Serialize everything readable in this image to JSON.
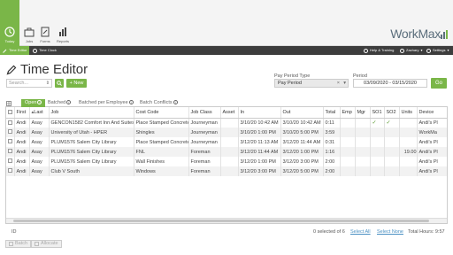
{
  "nav": {
    "items": [
      {
        "label": "Today",
        "icon": "today-icon"
      },
      {
        "label": "Jobs",
        "icon": "briefcase-icon"
      },
      {
        "label": "Forms",
        "icon": "forms-icon"
      },
      {
        "label": "Reports",
        "icon": "reports-icon"
      }
    ],
    "brand": {
      "text": "WorkMax",
      "suffix": ""
    }
  },
  "subnav": {
    "left": [
      {
        "label": "Time Editor",
        "icon": "time-editor-icon"
      },
      {
        "label": "Time Clock",
        "icon": "clock-icon"
      }
    ],
    "right": [
      {
        "label": "Help & Training",
        "icon": "help-icon"
      },
      {
        "label": "Zachary",
        "icon": "user-icon"
      },
      {
        "label": "Settings",
        "icon": "gear-icon"
      }
    ]
  },
  "page": {
    "title": "Time Editor"
  },
  "filters": {
    "search_placeholder": "Search...",
    "new_label": "+ New",
    "pay_period_type_label": "Pay Period Type",
    "pay_period_type_value": "Pay Period",
    "period_label": "Period",
    "period_value": "03/09/2020 - 03/15/2020",
    "go_label": "Go"
  },
  "tabs": [
    {
      "label": "Open",
      "active": true
    },
    {
      "label": "Batched",
      "active": false
    },
    {
      "label": "Batched per Employee",
      "active": false
    },
    {
      "label": "Batch Conflicts",
      "active": false
    }
  ],
  "table": {
    "columns": [
      "",
      "First",
      "Last",
      "Job",
      "Cost Code",
      "Job Class",
      "Asset",
      "In",
      "Out",
      "Total",
      "Emp",
      "Mgr",
      "SO1",
      "SO2",
      "Units",
      "Device"
    ],
    "rows": [
      {
        "first": "Andi",
        "last": "Asay",
        "job": "GENCON1582 Comfort Inn And Suites",
        "cost_code": "Place Stamped Concrete",
        "job_class": "Journeyman",
        "asset": "",
        "in": "3/10/20 10:42 AM",
        "out": "3/10/20 10:42 AM",
        "total": "0:11",
        "emp": "",
        "mgr": "",
        "so1": "✓",
        "so2": "✓",
        "units": "",
        "device": "Andi's Pl"
      },
      {
        "first": "Andi",
        "last": "Asay",
        "job": "University of Utah - HPER",
        "cost_code": "Shingles",
        "job_class": "Journeyman",
        "asset": "",
        "in": "3/10/20 1:00 PM",
        "out": "3/10/20 5:00 PM",
        "total": "3:59",
        "emp": "",
        "mgr": "",
        "so1": "",
        "so2": "",
        "units": "",
        "device": "WorkMa"
      },
      {
        "first": "Andi",
        "last": "Asay",
        "job": "PLUM1576 Salem City Library",
        "cost_code": "Place Stamped Concrete",
        "job_class": "Journeyman",
        "asset": "",
        "in": "3/12/20 11:13 AM",
        "out": "3/12/20 11:44 AM",
        "total": "0:31",
        "emp": "",
        "mgr": "",
        "so1": "",
        "so2": "",
        "units": "",
        "device": "Andi's Pl"
      },
      {
        "first": "Andi",
        "last": "Asay",
        "job": "PLUM1576 Salem City Library",
        "cost_code": "FNL",
        "job_class": "Foreman",
        "asset": "",
        "in": "3/12/20 11:44 AM",
        "out": "3/12/20 1:00 PM",
        "total": "1:16",
        "emp": "",
        "mgr": "",
        "so1": "",
        "so2": "",
        "units": "19.00",
        "device": "Andi's Pl"
      },
      {
        "first": "Andi",
        "last": "Asay",
        "job": "PLUM1576 Salem City Library",
        "cost_code": "Wall Finishes",
        "job_class": "Foreman",
        "asset": "",
        "in": "3/12/20 1:00 PM",
        "out": "3/12/20 3:00 PM",
        "total": "2:00",
        "emp": "",
        "mgr": "",
        "so1": "",
        "so2": "",
        "units": "",
        "device": "Andi's Pl"
      },
      {
        "first": "Andi",
        "last": "Asay",
        "job": "Club V South",
        "cost_code": "Windows",
        "job_class": "Foreman",
        "asset": "",
        "in": "3/12/20 3:00 PM",
        "out": "3/12/20 5:00 PM",
        "total": "2:00",
        "emp": "",
        "mgr": "",
        "so1": "",
        "so2": "",
        "units": "",
        "device": "Andi's Pl"
      }
    ]
  },
  "footer": {
    "id_label": "ID",
    "selected": "0 selected of 6",
    "select_all": "Select All",
    "select_none": "Select None",
    "total_hours": "Total Hours: 9:57"
  },
  "actions": {
    "batch_label": "Batch",
    "allocate_label": "Allocate"
  },
  "colors": {
    "accent": "#7ab648",
    "dark_bar": "#3d3d3d",
    "link": "#4a90c2"
  }
}
